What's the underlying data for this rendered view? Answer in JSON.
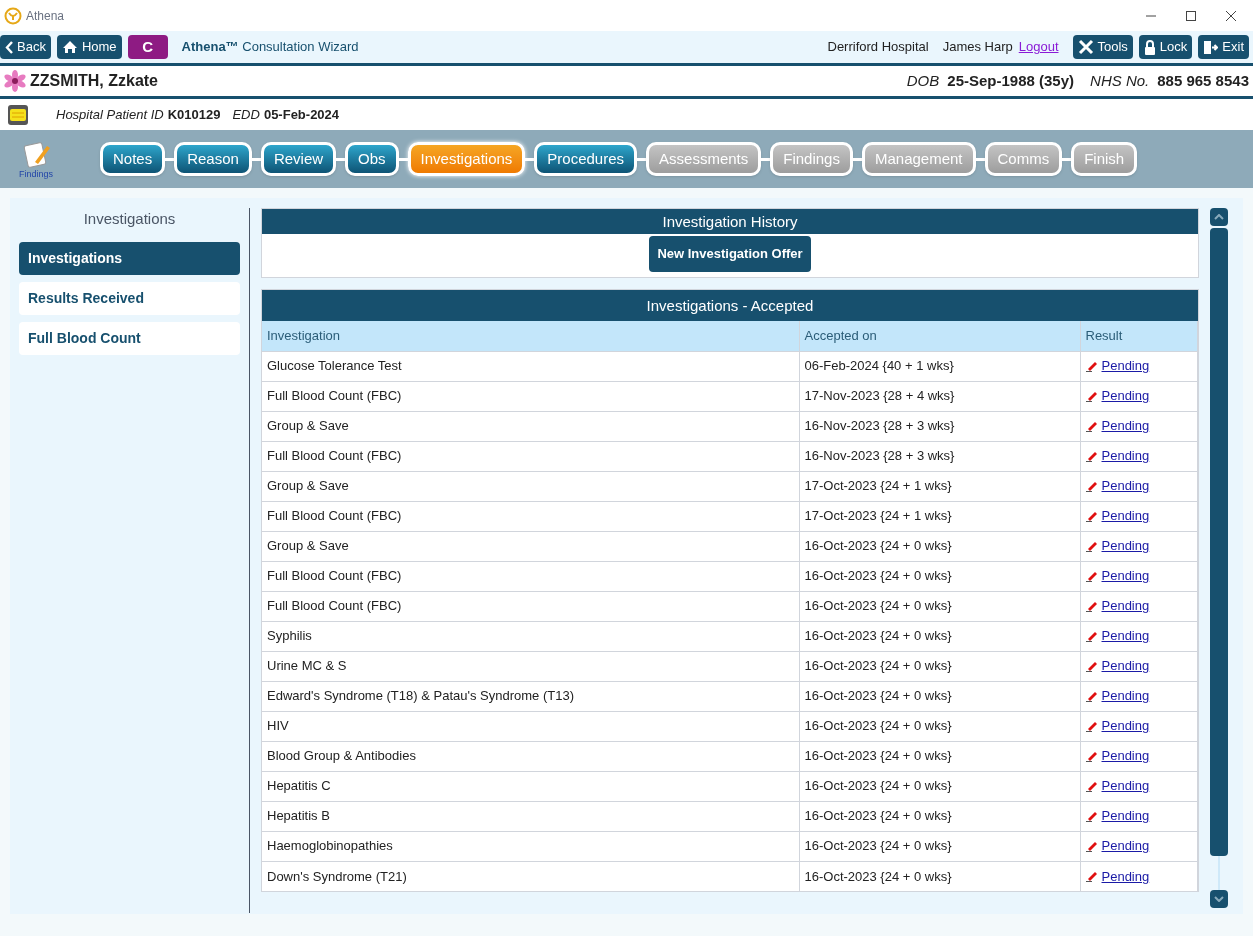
{
  "window": {
    "title": "Athena"
  },
  "toolbar": {
    "buttons": [
      {
        "kind": "back",
        "label": "Back"
      },
      {
        "kind": "home",
        "label": "Home"
      },
      {
        "kind": "consult",
        "label": "C"
      }
    ],
    "app_name": "Athena™",
    "app_subtitle": "Consultation Wizard",
    "hospital": "Derriford Hospital",
    "user": "James Harp",
    "logout": "Logout",
    "right_buttons": [
      {
        "kind": "tools",
        "label": "Tools"
      },
      {
        "kind": "lock",
        "label": "Lock"
      },
      {
        "kind": "exit",
        "label": "Exit"
      }
    ]
  },
  "patient": {
    "name": "ZZSMITH, Zzkate",
    "dob_label": "DOB",
    "dob": "25-Sep-1988 (35y)",
    "nhs_label": "NHS No.",
    "nhs": "885 965 8543",
    "id_label": "Hospital Patient ID",
    "id": "K010129",
    "edd_label": "EDD",
    "edd": "05-Feb-2024"
  },
  "wizard": {
    "icon_label": "Findings",
    "steps": [
      {
        "label": "Notes",
        "enabled": true,
        "selected": false
      },
      {
        "label": "Reason",
        "enabled": true,
        "selected": false
      },
      {
        "label": "Review",
        "enabled": true,
        "selected": false
      },
      {
        "label": "Obs",
        "enabled": true,
        "selected": false
      },
      {
        "label": "Investigations",
        "enabled": true,
        "selected": true
      },
      {
        "label": "Procedures",
        "enabled": true,
        "selected": false
      },
      {
        "label": "Assessments",
        "enabled": false,
        "selected": false
      },
      {
        "label": "Findings",
        "enabled": false,
        "selected": false
      },
      {
        "label": "Management",
        "enabled": false,
        "selected": false
      },
      {
        "label": "Comms",
        "enabled": false,
        "selected": false
      },
      {
        "label": "Finish",
        "enabled": false,
        "selected": false
      }
    ]
  },
  "sidebar": {
    "title": "Investigations",
    "items": [
      {
        "label": "Investigations",
        "selected": true
      },
      {
        "label": "Results Received",
        "selected": false
      },
      {
        "label": "Full Blood Count",
        "selected": false
      }
    ]
  },
  "history": {
    "title": "Investigation History",
    "button": "New Investigation Offer"
  },
  "table": {
    "title": "Investigations - Accepted",
    "columns": [
      "Investigation",
      "Accepted on",
      "Result"
    ],
    "rows": [
      [
        "Glucose Tolerance Test",
        "06-Feb-2024 {40 + 1 wks}",
        "Pending"
      ],
      [
        "Full Blood Count (FBC)",
        "17-Nov-2023 {28 + 4 wks}",
        "Pending"
      ],
      [
        "Group & Save",
        "16-Nov-2023 {28 + 3 wks}",
        "Pending"
      ],
      [
        "Full Blood Count (FBC)",
        "16-Nov-2023 {28 + 3 wks}",
        "Pending"
      ],
      [
        "Group & Save",
        "17-Oct-2023 {24 + 1 wks}",
        "Pending"
      ],
      [
        "Full Blood Count (FBC)",
        "17-Oct-2023 {24 + 1 wks}",
        "Pending"
      ],
      [
        "Group & Save",
        "16-Oct-2023 {24 + 0 wks}",
        "Pending"
      ],
      [
        "Full Blood Count (FBC)",
        "16-Oct-2023 {24 + 0 wks}",
        "Pending"
      ],
      [
        "Full Blood Count (FBC)",
        "16-Oct-2023 {24 + 0 wks}",
        "Pending"
      ],
      [
        "Syphilis",
        "16-Oct-2023 {24 + 0 wks}",
        "Pending"
      ],
      [
        "Urine MC & S",
        "16-Oct-2023 {24 + 0 wks}",
        "Pending"
      ],
      [
        "Edward's Syndrome (T18) & Patau's Syndrome (T13)",
        "16-Oct-2023 {24 + 0 wks}",
        "Pending"
      ],
      [
        "HIV",
        "16-Oct-2023 {24 + 0 wks}",
        "Pending"
      ],
      [
        "Blood Group & Antibodies",
        "16-Oct-2023 {24 + 0 wks}",
        "Pending"
      ],
      [
        "Hepatitis C",
        "16-Oct-2023 {24 + 0 wks}",
        "Pending"
      ],
      [
        "Hepatitis B",
        "16-Oct-2023 {24 + 0 wks}",
        "Pending"
      ],
      [
        "Haemoglobinopathies",
        "16-Oct-2023 {24 + 0 wks}",
        "Pending"
      ],
      [
        "Down's Syndrome (T21)",
        "16-Oct-2023 {24 + 0 wks}",
        "Pending"
      ]
    ]
  }
}
